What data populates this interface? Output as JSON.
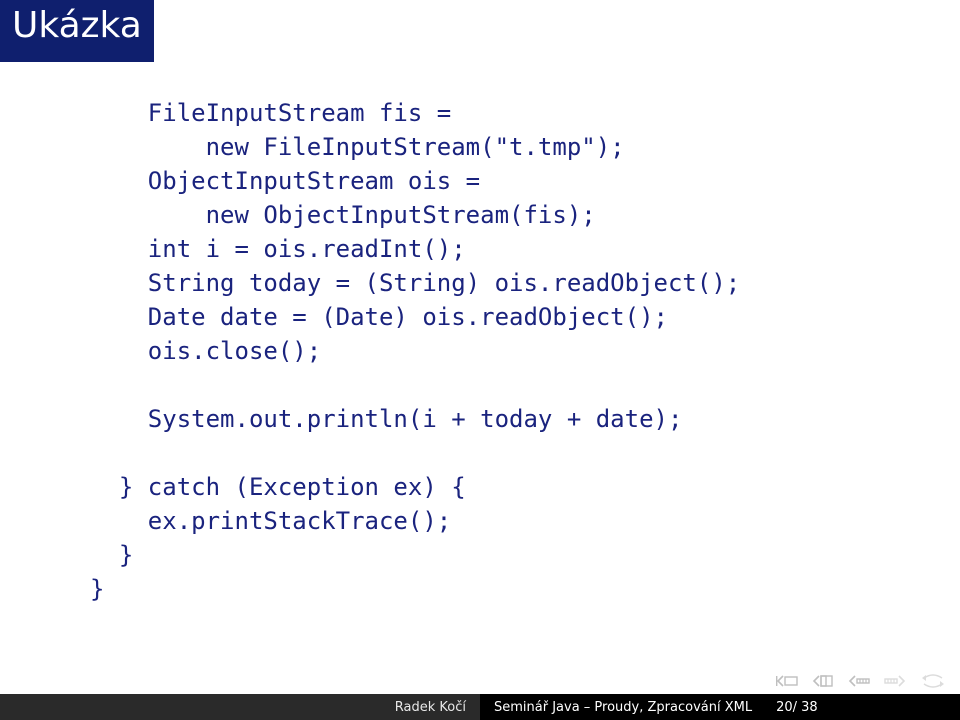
{
  "title": "Ukázka",
  "code": "    FileInputStream fis =\n        new FileInputStream(\"t.tmp\");\n    ObjectInputStream ois =\n        new ObjectInputStream(fis);\n    int i = ois.readInt();\n    String today = (String) ois.readObject();\n    Date date = (Date) ois.readObject();\n    ois.close();\n\n    System.out.println(i + today + date);\n\n  } catch (Exception ex) {\n    ex.printStackTrace();\n  }\n}",
  "footer": {
    "author": "Radek Kočí",
    "talk": "Seminář Java – Proudy, Zpracování XML",
    "pages": "20/ 38"
  }
}
